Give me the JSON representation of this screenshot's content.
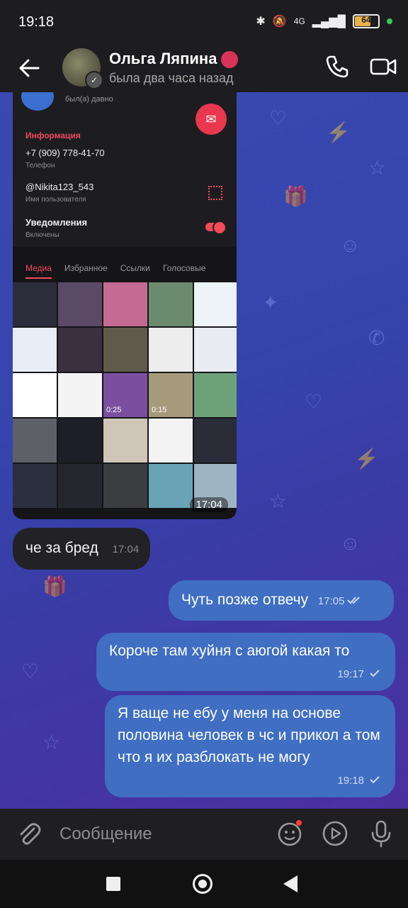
{
  "status_bar": {
    "time": "19:18",
    "network": "4G",
    "battery": "64",
    "battery_fraction": 0.64
  },
  "header": {
    "name": "Ольга Ляпина",
    "last_seen": "была два часа назад"
  },
  "shared_screenshot": {
    "last_seen": "был(а) давно",
    "section_title": "Информация",
    "phone": "+7 (909) 778-41-70",
    "phone_label": "Телефон",
    "username": "@Nikita123_543",
    "username_label": "Имя пользователя",
    "notifications": "Уведомления",
    "notifications_state": "Включены",
    "tabs": [
      "Медиа",
      "Избранное",
      "Ссылки",
      "Голосовые"
    ],
    "video_durations": [
      "0:25",
      "0:15"
    ],
    "timestamp": "17:04"
  },
  "messages": [
    {
      "direction": "in",
      "text": "че за бред",
      "time": "17:04"
    },
    {
      "direction": "out",
      "text": "Чуть позже отвечу",
      "time": "17:05"
    },
    {
      "direction": "out",
      "text": "Короче там хуйня с аюгой какая то",
      "time": "19:17"
    },
    {
      "direction": "out",
      "text": "Я ваще не ебу у меня на основе половина человек в чс и прикол а том что я их разблокать не могу",
      "time": "19:18"
    }
  ],
  "input": {
    "placeholder": "Сообщение"
  },
  "colors": {
    "accent": "#f04a5b",
    "outgoing": "#3f6ec2",
    "incoming": "#222226"
  }
}
